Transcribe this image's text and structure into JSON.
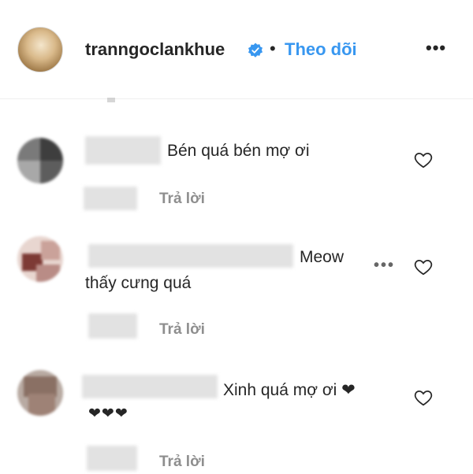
{
  "header": {
    "username": "tranngoclankhue",
    "separator": "•",
    "follow_label": "Theo dõi",
    "more_label": "•••",
    "accent_color": "#3897f0"
  },
  "comments": [
    {
      "text_line1": "Bén quá bén mợ ơi",
      "text_line2": "",
      "reply_label": "Trả lời"
    },
    {
      "text_line1": "Meow",
      "text_line2": "thấy cưng quá",
      "reply_label": "Trả lời",
      "more_label": "•••"
    },
    {
      "text_line1": "Xinh quá mợ ơi ❤",
      "text_line2": "❤❤❤",
      "reply_label": "Trả lời"
    }
  ],
  "icons": {
    "verified": "verified-badge-icon",
    "heart": "heart-outline-icon",
    "more": "more-horizontal-icon"
  }
}
